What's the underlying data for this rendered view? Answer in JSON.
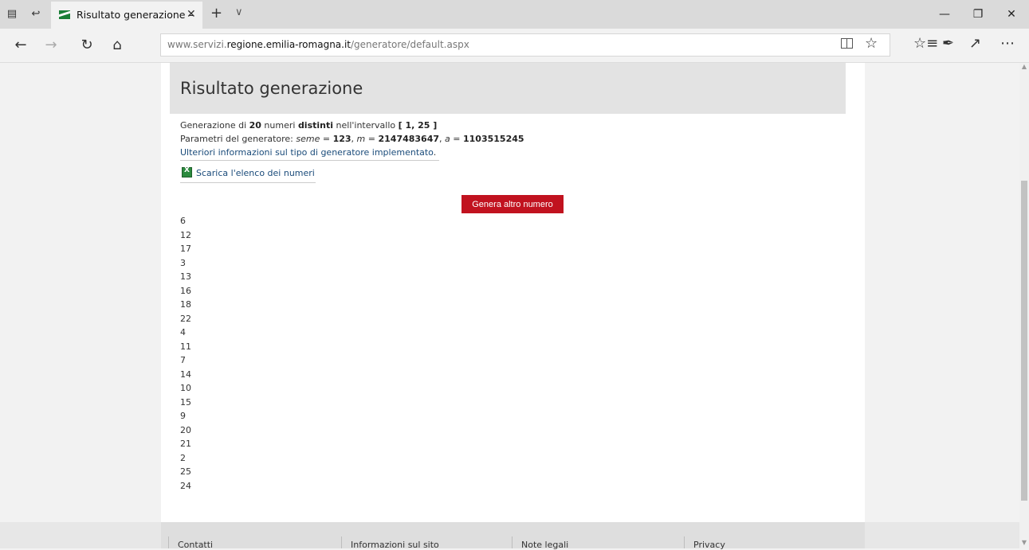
{
  "browser": {
    "tab_title": "Risultato generazione –",
    "tab_close": "✕",
    "new_tab": "+",
    "tab_dropdown": "∨",
    "url_prefix": "www.servizi.",
    "url_domain": "regione.emilia-romagna.it",
    "url_path": "/generatore/default.aspx"
  },
  "page": {
    "title": "Risultato generazione",
    "gen_pre": "Generazione di ",
    "gen_count": "20",
    "gen_mid": " numeri ",
    "gen_distinct": "distinti",
    "gen_post": " nell'intervallo ",
    "gen_range": "[ 1, 25 ]",
    "params_pre": "Parametri del generatore: ",
    "seme_label": "seme",
    "seme_eq": " = ",
    "seme_val": "123",
    "m_sep": ", ",
    "m_label": "m",
    "m_eq": " = ",
    "m_val": "2147483647",
    "a_sep": ", ",
    "a_label": "a",
    "a_eq": " = ",
    "a_val": "1103515245",
    "info_link": "Ulteriori informazioni sul tipo di generatore implementato",
    "info_link_dot": ".",
    "download_link": "Scarica l'elenco dei numeri",
    "generate_button": "Genera altro numero",
    "numbers": [
      "6",
      "12",
      "17",
      "3",
      "13",
      "16",
      "18",
      "22",
      "4",
      "11",
      "7",
      "14",
      "10",
      "15",
      "9",
      "20",
      "21",
      "2",
      "25",
      "24"
    ]
  },
  "footer": {
    "items": [
      "Contatti",
      "Informazioni sul sito",
      "Note legali",
      "Privacy"
    ]
  },
  "colors": {
    "button_red": "#c1121f",
    "link_blue": "#1a4b7a",
    "header_gray": "#e3e3e3"
  }
}
